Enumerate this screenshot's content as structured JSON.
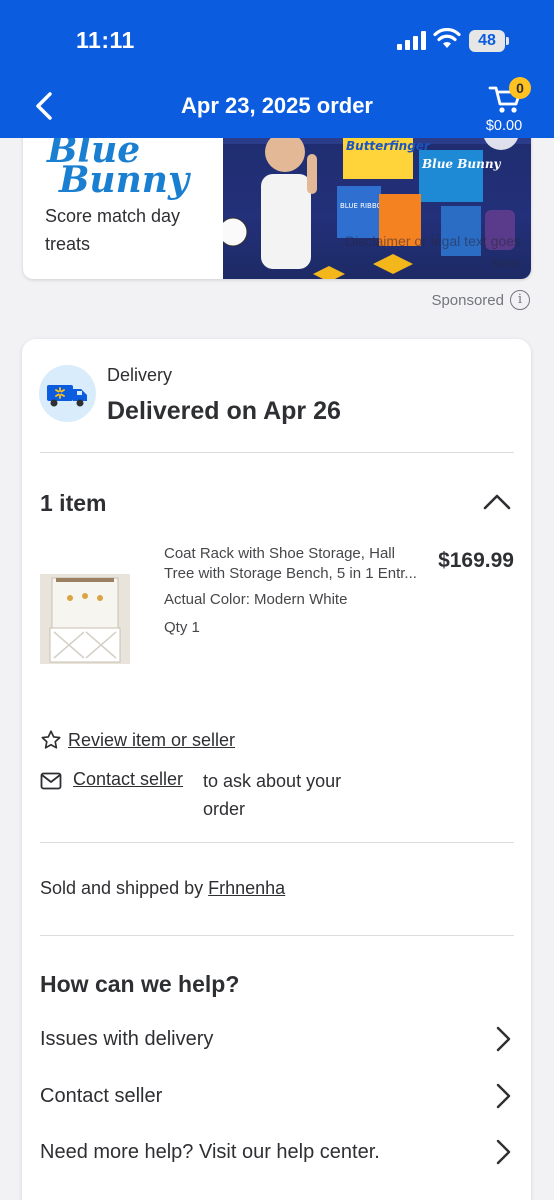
{
  "status_bar": {
    "time": "11:11",
    "battery": "48"
  },
  "header": {
    "title": "Apr 23, 2025 order",
    "cart_count": "0",
    "cart_total": "$0.00"
  },
  "ad": {
    "brand": "Blue Bunny",
    "brand_line1": "Blue",
    "brand_line2": "Bunny",
    "tagline": "Score match day treats",
    "disclaimer": "Disclaimer or legal text goes here",
    "sponsored_label": "Sponsored",
    "product_labels": [
      "Butterfinger",
      "Blue Bunny",
      "BLUE RIBBON"
    ]
  },
  "delivery": {
    "label": "Delivery",
    "status": "Delivered on Apr 26"
  },
  "items": {
    "count_label": "1 item",
    "list": [
      {
        "title_line1": "Coat Rack with Shoe Storage, Hall",
        "title_line2": "Tree with Storage Bench, 5 in 1 Entr...",
        "price": "$169.99",
        "color": "Actual Color: Modern White",
        "qty": "Qty 1"
      }
    ]
  },
  "actions": {
    "review": "Review item or seller",
    "contact": "Contact seller",
    "contact_note": "to ask about your order"
  },
  "seller": {
    "prefix": "Sold and shipped by ",
    "name": "Frhnenha"
  },
  "help": {
    "title": "How can we help?",
    "options": [
      "Issues with delivery",
      "Contact seller",
      "Need more help? Visit our help center."
    ]
  },
  "colors": {
    "brand_blue": "#0c5ce0",
    "spark_yellow": "#ffc220",
    "text": "#2e2f32"
  }
}
